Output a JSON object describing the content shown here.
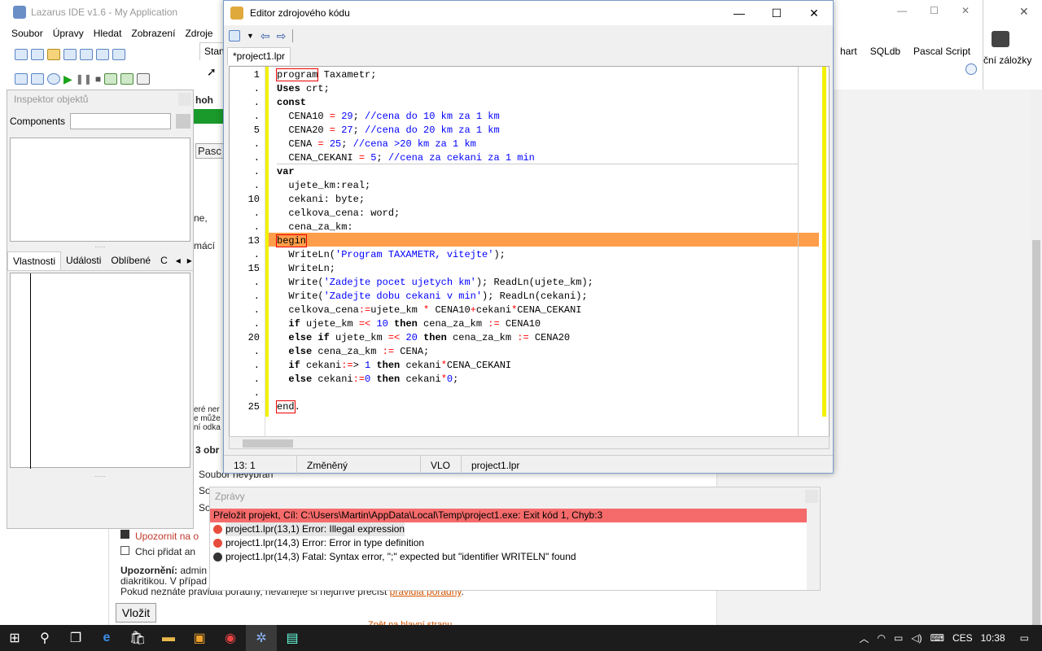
{
  "main_window": {
    "title": "Lazarus IDE v1.6 - My Application",
    "menu": [
      "Soubor",
      "Úpravy",
      "Hledat",
      "Zobrazení",
      "Zdroje"
    ],
    "tab_fragment": "Stan"
  },
  "inspector": {
    "title": "Inspektor objektů",
    "components_label": "Components",
    "tabs": [
      "Vlastnosti",
      "Události",
      "Oblíbené",
      "C"
    ]
  },
  "background_fragments": {
    "hoh": "hoh",
    "pasc": "Pasc",
    "ne": "ne,",
    "maci": "mácí",
    "ere_ner": "eré ner",
    "e_muze": "e může",
    "i_odka": "ní odka",
    "obr": "3 obr",
    "soubor_nevybran": "Soubor nevybrán",
    "so1": "So",
    "so2": "So",
    "upozornit": "Upozornit na o",
    "chci_pridat": "Chci přidat an",
    "upozorneni_bold": "Upozornění:",
    "upozorneni_text": " admin",
    "diakritikou": "diakritikou. V případ",
    "pokud": "Pokud neznáte pravidla poradny, nevahejte si nejdříve přečíst ",
    "pravidla_link": "pravidla poradny",
    "pokud_end": ".",
    "vlozit": "Vložit",
    "zpet": "Zpět na hlavní stranu"
  },
  "editor": {
    "title": "Editor zdrojového kódu",
    "tab": "*project1.lpr",
    "status": {
      "position": "13:  1",
      "state": "Změněný",
      "mode": "VLO",
      "file": "project1.lpr"
    }
  },
  "code_lines": [
    {
      "n": "1",
      "t": "program Taxametr;"
    },
    {
      "n": ".",
      "t": "Uses crt;"
    },
    {
      "n": ".",
      "t": "const"
    },
    {
      "n": ".",
      "t": "  CENA10 = 29; //cena do 10 km za 1 km"
    },
    {
      "n": "5",
      "t": "  CENA20 = 27; //cena do 20 km za 1 km"
    },
    {
      "n": ".",
      "t": "  CENA = 25; //cena >20 km za 1 km"
    },
    {
      "n": ".",
      "t": "  CENA_CEKANI = 5; //cena za cekani za 1 min"
    },
    {
      "n": ".",
      "t": "var"
    },
    {
      "n": ".",
      "t": "  ujete_km:real;"
    },
    {
      "n": "10",
      "t": "  cekani: byte;"
    },
    {
      "n": ".",
      "t": "  celkova_cena: word;"
    },
    {
      "n": ".",
      "t": "  cena_za_km:"
    },
    {
      "n": "13",
      "t": "begin"
    },
    {
      "n": ".",
      "t": "  WriteLn('Program TAXAMETR, vitejte');"
    },
    {
      "n": "15",
      "t": "  WriteLn;"
    },
    {
      "n": ".",
      "t": "  Write('Zadejte pocet ujetych km'); ReadLn(ujete_km);"
    },
    {
      "n": ".",
      "t": "  Write('Zadejte dobu cekani v min'); ReadLn(cekani);"
    },
    {
      "n": ".",
      "t": "  celkova_cena:=ujete_km * CENA10+cekani*CENA_CEKANI"
    },
    {
      "n": ".",
      "t": "  if ujete_km =< 10 then cena_za_km := CENA10"
    },
    {
      "n": "20",
      "t": "  else if ujete_km =< 20 then cena_za_km := CENA20"
    },
    {
      "n": ".",
      "t": "  else cena_za_km := CENA;"
    },
    {
      "n": ".",
      "t": "  if cekani:=> 1 then cekani*CENA_CEKANI"
    },
    {
      "n": ".",
      "t": "  else cekani:=0 then cekani*0;"
    },
    {
      "n": ".",
      "t": ""
    },
    {
      "n": "25",
      "t": "end."
    }
  ],
  "ide_right": {
    "tabs": [
      "hart",
      "SQLdb",
      "Pascal Script"
    ],
    "fragment": "ční záložky"
  },
  "messages": {
    "title": "Zprávy",
    "items": [
      "Přeložit projekt, Cíl: C:\\Users\\Martin\\AppData\\Local\\Temp\\project1.exe: Exit kód 1, Chyb:3",
      "project1.lpr(13,1) Error: Illegal expression",
      "project1.lpr(14,3) Error: Error in type definition",
      "project1.lpr(14,3) Fatal: Syntax error, \";\" expected but \"identifier WRITELN\" found"
    ]
  },
  "taskbar": {
    "lang": "CES",
    "time": "10:38"
  },
  "colors": {
    "highlight_line": "#ff9e4a",
    "gutter_bar": "#f3f100",
    "error_header": "#f56b6b"
  }
}
